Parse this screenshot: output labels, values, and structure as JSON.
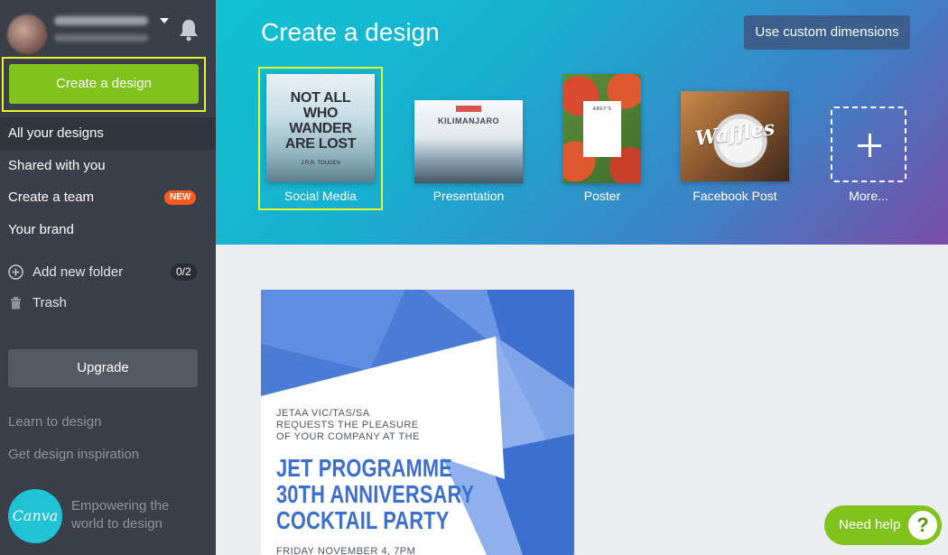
{
  "sidebar": {
    "create_label": "Create a design",
    "nav": [
      {
        "label": "All your designs"
      },
      {
        "label": "Shared with you"
      },
      {
        "label": "Create a team",
        "badge": "NEW"
      },
      {
        "label": "Your brand"
      }
    ],
    "add_folder_label": "Add new folder",
    "folder_count": "0/2",
    "trash_label": "Trash",
    "upgrade_label": "Upgrade",
    "learn_link": "Learn to design",
    "inspiration_link": "Get design inspiration",
    "logo_text": "Canva",
    "tagline": "Empowering the world to design"
  },
  "header": {
    "title": "Create a design",
    "custom_dimensions_label": "Use custom dimensions",
    "templates": [
      {
        "label": "Social Media",
        "thumb_text": "NOT ALL WHO WANDER ARE LOST",
        "thumb_sub": "J.R.R. TOLKIEN"
      },
      {
        "label": "Presentation",
        "thumb_text": "KILIMANJARO"
      },
      {
        "label": "Poster",
        "thumb_text": "ABEY'S"
      },
      {
        "label": "Facebook Post",
        "thumb_text": "Waffles"
      },
      {
        "label": "More..."
      }
    ]
  },
  "design": {
    "intro": "JETAA VIC/TAS/SA\nREQUESTS THE PLEASURE\nOF YOUR COMPANY AT THE",
    "headline": "JET PROGRAMME\n30TH ANNIVERSARY\nCOCKTAIL PARTY",
    "date": "FRIDAY NOVEMBER 4, 7PM"
  },
  "help": {
    "label": "Need help",
    "icon": "?"
  },
  "colors": {
    "sidebar_bg": "#3a3f4a",
    "accent_green": "#80c31c",
    "highlight_yellow": "#e9f530",
    "new_badge": "#ff5a1f"
  }
}
